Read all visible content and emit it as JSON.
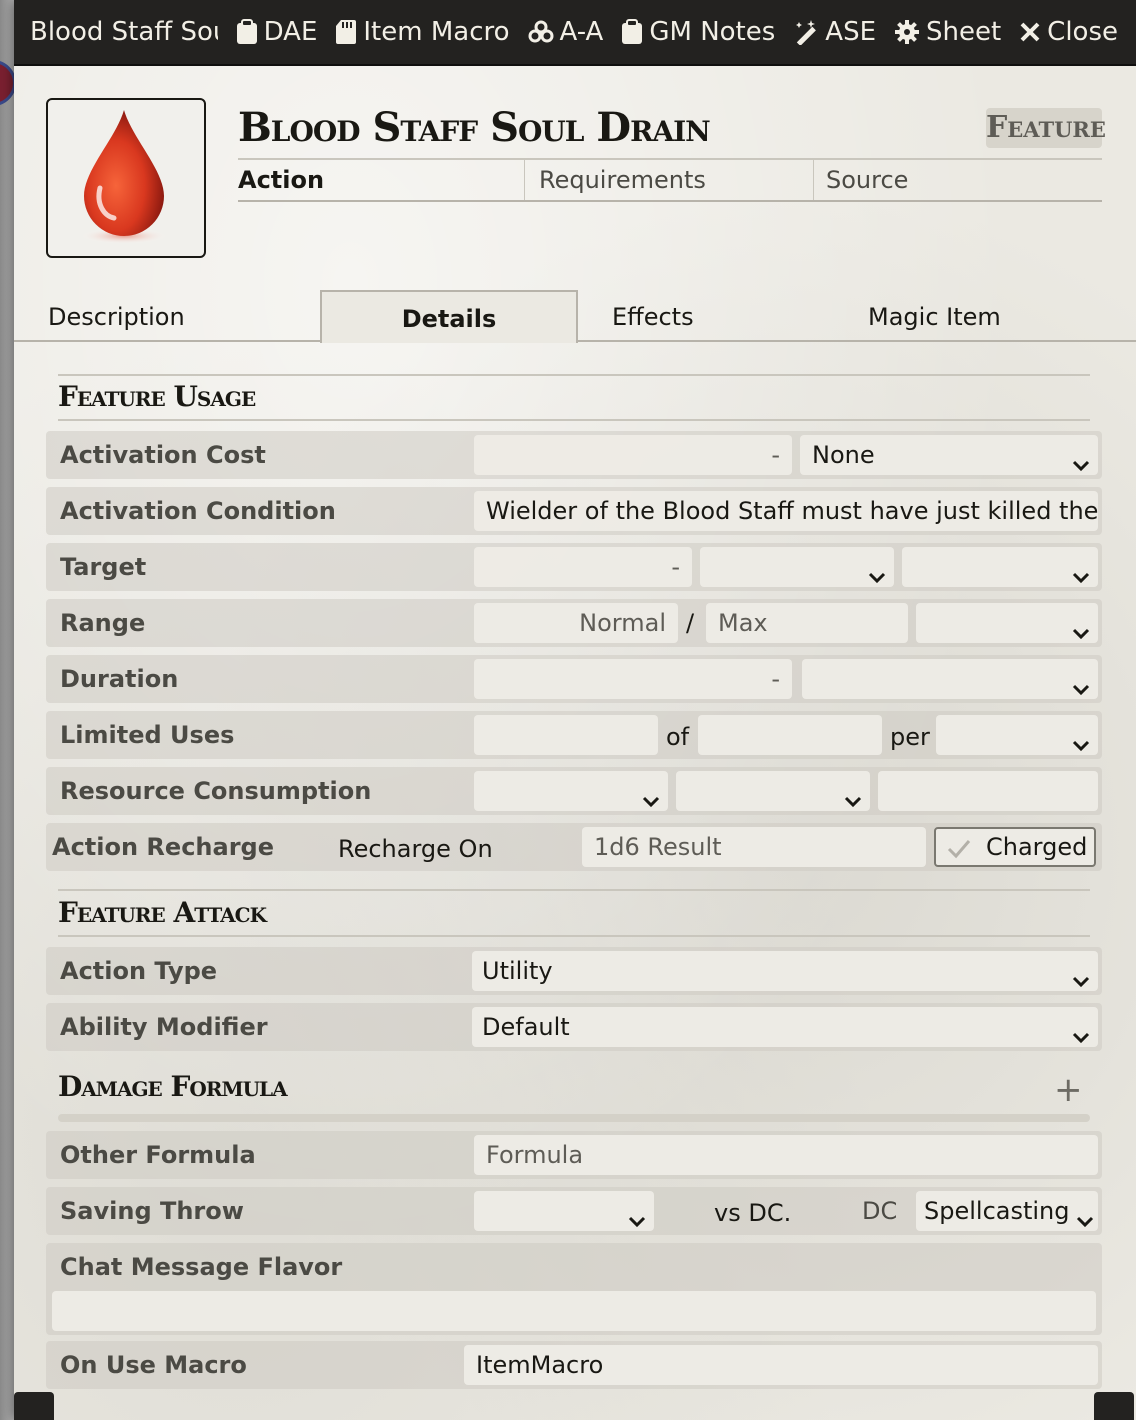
{
  "window": {
    "title": "Blood Staff Soul Dr",
    "buttons": [
      "DAE",
      "Item Macro",
      "A-A",
      "GM Notes",
      "ASE",
      "Sheet",
      "Close"
    ]
  },
  "item": {
    "name": "Blood Staff Soul Drain",
    "type_badge": "Feature",
    "activation": "Action",
    "requirements_placeholder": "Requirements",
    "source_placeholder": "Source",
    "image_icon": "blood-drop-icon"
  },
  "tabs": [
    "Description",
    "Details",
    "Effects",
    "Magic Item"
  ],
  "active_tab": "Details",
  "feature_usage": {
    "title": "Feature Usage",
    "activation_cost": {
      "label": "Activation Cost",
      "value": "-",
      "type": "None"
    },
    "activation_condition": {
      "label": "Activation Condition",
      "value": "Wielder of the Blood Staff must have just killed the tar"
    },
    "target": {
      "label": "Target",
      "value": "-"
    },
    "range": {
      "label": "Range",
      "normal": "Normal",
      "separator": "/",
      "max": "Max"
    },
    "duration": {
      "label": "Duration",
      "value": "-"
    },
    "limited_uses": {
      "label": "Limited Uses",
      "of": "of",
      "per": "per"
    },
    "resource_consumption": {
      "label": "Resource Consumption"
    },
    "action_recharge": {
      "label": "Action Recharge",
      "recharge_on": "Recharge On",
      "result_placeholder": "1d6 Result",
      "charged": "Charged"
    }
  },
  "feature_attack": {
    "title": "Feature Attack",
    "action_type": {
      "label": "Action Type",
      "value": "Utility"
    },
    "ability_modifier": {
      "label": "Ability Modifier",
      "value": "Default"
    }
  },
  "damage_formula": {
    "title": "Damage Formula",
    "add_symbol": "+",
    "other_formula": {
      "label": "Other Formula",
      "placeholder": "Formula"
    },
    "saving_throw": {
      "label": "Saving Throw",
      "vs": "vs DC.",
      "dc_label": "DC",
      "dc_source": "Spellcasting"
    },
    "chat_flavor": {
      "label": "Chat Message Flavor",
      "value": ""
    },
    "on_use_macro": {
      "label": "On Use Macro",
      "value": "ItemMacro"
    }
  },
  "colors": {
    "header_bg": "#232220",
    "parchment": "#ebe9e2",
    "accent_red": "#c4321b"
  }
}
